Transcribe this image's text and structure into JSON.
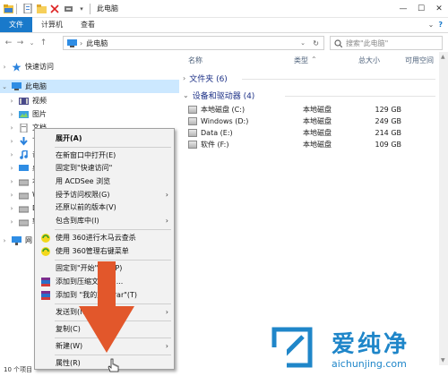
{
  "window": {
    "title": "此电脑",
    "minimize": "—",
    "maximize": "☐",
    "close": "✕"
  },
  "ribbon": {
    "tabs": [
      "文件",
      "计算机",
      "查看"
    ],
    "help": "?"
  },
  "address": {
    "path": "此电脑",
    "search_placeholder": "搜索\"此电脑\""
  },
  "nav": {
    "items": [
      {
        "label": "快速访问"
      },
      {
        "label": "此电脑"
      },
      {
        "label": "视频"
      },
      {
        "label": "图片"
      },
      {
        "label": "文档"
      },
      {
        "label": "下"
      },
      {
        "label": "音"
      },
      {
        "label": "桌"
      },
      {
        "label": "本"
      },
      {
        "label": "W"
      },
      {
        "label": "D"
      },
      {
        "label": "软"
      },
      {
        "label": "网"
      }
    ]
  },
  "columns": {
    "name": "名称",
    "type": "类型",
    "total": "总大小",
    "free": "可用空间"
  },
  "sections": {
    "folders": "文件夹 (6)",
    "devices": "设备和驱动器 (4)"
  },
  "drives": [
    {
      "name": "本地磁盘 (C:)",
      "type": "本地磁盘",
      "total": "129 GB"
    },
    {
      "name": "Windows (D:)",
      "type": "本地磁盘",
      "total": "249 GB"
    },
    {
      "name": "Data (E:)",
      "type": "本地磁盘",
      "total": "214 GB"
    },
    {
      "name": "软件 (F:)",
      "type": "本地磁盘",
      "total": "109 GB"
    }
  ],
  "context_menu": {
    "items": [
      {
        "label": "展开(A)",
        "bold": true
      },
      {
        "label": "在新窗口中打开(E)"
      },
      {
        "label": "固定到\"快速访问\""
      },
      {
        "label": "用 ACDSee 浏览"
      },
      {
        "label": "授予访问权限(G)",
        "submenu": true
      },
      {
        "label": "还原以前的版本(V)"
      },
      {
        "label": "包含到库中(I)",
        "submenu": true
      },
      {
        "label": "使用 360进行木马云查杀",
        "icon": "360-icon"
      },
      {
        "label": "使用 360管理右键菜单",
        "icon": "360-icon"
      },
      {
        "label": "固定到\"开始\"屏幕(P)"
      },
      {
        "label": "添加到压缩文件(A)...",
        "icon": "winrar-icon"
      },
      {
        "label": "添加到 \"我的文档.rar\"(T)",
        "icon": "winrar-icon"
      },
      {
        "label": "发送到(N)",
        "submenu": true
      },
      {
        "label": "复制(C)"
      },
      {
        "label": "新建(W)",
        "submenu": true
      },
      {
        "label": "属性(R)"
      }
    ],
    "arrow_glyph": "›"
  },
  "status": {
    "items_count": "10 个项目"
  },
  "watermark": {
    "brand": "爱纯净",
    "url": "aichunjing.com"
  },
  "colors": {
    "accent": "#1979ca",
    "selection": "#cce8ff",
    "arrow": "#e2572b",
    "watermark": "#1f86c9"
  }
}
